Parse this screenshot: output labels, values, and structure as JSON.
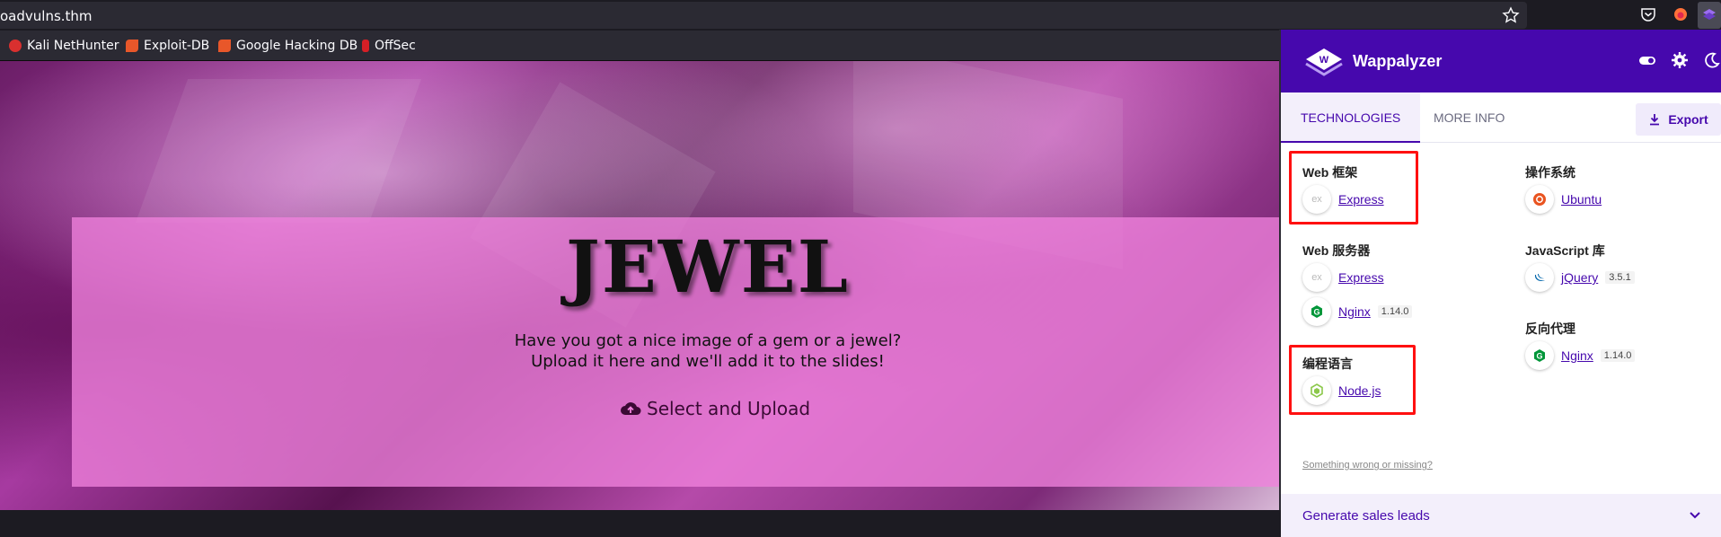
{
  "browser": {
    "url": "oadvulns.thm",
    "bookmarks": [
      "Kali NetHunter",
      "Exploit-DB",
      "Google Hacking DB",
      "OffSec"
    ]
  },
  "page": {
    "title": "JEWEL",
    "intro_line1": "Have you got a nice image of a gem or a jewel?",
    "intro_line2": "Upload it here and we'll add it to the slides!",
    "upload_label": "Select and Upload"
  },
  "wappalyzer": {
    "brand": "Wappalyzer",
    "tabs": [
      "TECHNOLOGIES",
      "MORE INFO"
    ],
    "export_label": "Export",
    "categories": {
      "web_framework": {
        "label": "Web 框架",
        "items": [
          {
            "name": "Express",
            "icon": "ex"
          }
        ]
      },
      "web_server": {
        "label": "Web 服务器",
        "items": [
          {
            "name": "Express",
            "icon": "ex"
          },
          {
            "name": "Nginx",
            "version": "1.14.0"
          }
        ]
      },
      "programming_language": {
        "label": "编程语言",
        "items": [
          {
            "name": "Node.js"
          }
        ]
      },
      "os": {
        "label": "操作系统",
        "items": [
          {
            "name": "Ubuntu"
          }
        ]
      },
      "js_library": {
        "label": "JavaScript 库",
        "items": [
          {
            "name": "jQuery",
            "version": "3.5.1"
          }
        ]
      },
      "reverse_proxy": {
        "label": "反向代理",
        "items": [
          {
            "name": "Nginx",
            "version": "1.14.0"
          }
        ]
      }
    },
    "feedback_link": "Something wrong or missing?",
    "leads_label": "Generate sales leads"
  },
  "colors": {
    "accent": "#4608ad",
    "highlight": "#ff1010"
  }
}
